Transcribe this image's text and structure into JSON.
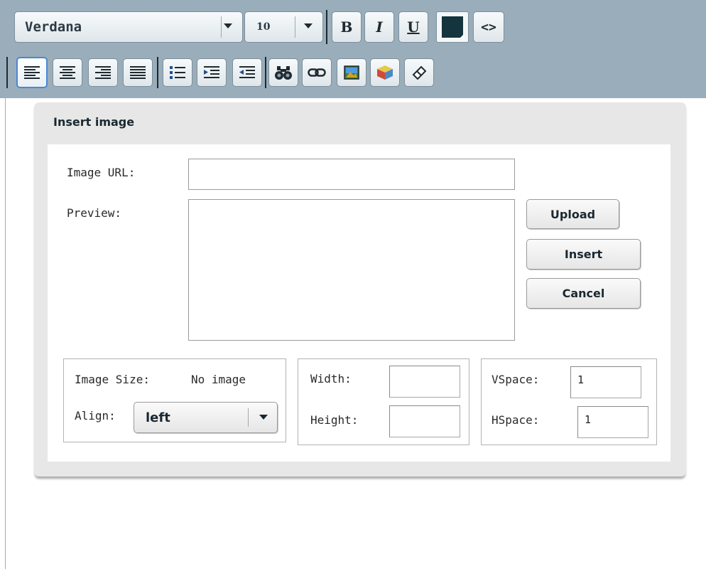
{
  "toolbar": {
    "font_family": "Verdana",
    "font_size": "10",
    "bold_label": "B",
    "italic_label": "I",
    "underline_label": "U",
    "source_label": "<>",
    "text_color": "#14343e",
    "icons": [
      "align-left-icon",
      "align-center-icon",
      "align-right-icon",
      "align-justify-icon",
      "bulleted-list-icon",
      "indent-icon",
      "outdent-icon",
      "find-binoculars-icon",
      "link-chain-icon",
      "image-icon",
      "cube-object-icon",
      "eraser-icon"
    ]
  },
  "dialog": {
    "title": "Insert image",
    "image_url_label": "Image URL:",
    "image_url_value": "",
    "preview_label": "Preview:",
    "upload_label": "Upload",
    "insert_label": "Insert",
    "cancel_label": "Cancel",
    "image_size_label": "Image Size:",
    "image_size_value": "No image",
    "align_label": "Align:",
    "align_value": "left",
    "width_label": "Width:",
    "width_value": "",
    "height_label": "Height:",
    "height_value": "",
    "vspace_label": "VSpace:",
    "vspace_value": "1",
    "hspace_label": "HSpace:",
    "hspace_value": "1"
  },
  "colors": {
    "toolbar_bg": "#9aadba",
    "dialog_bg": "#e7e7e7",
    "selected_border": "#4a87d6"
  }
}
